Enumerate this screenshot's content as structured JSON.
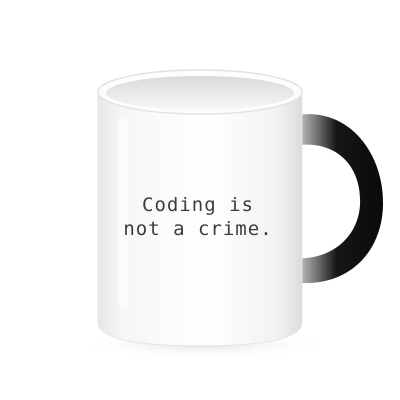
{
  "mug": {
    "line_1": "Coding is",
    "line_2": "not a crime.",
    "body_color": "#f4f4f4",
    "handle_color": "#111111",
    "text_color": "#1a1a1a"
  }
}
